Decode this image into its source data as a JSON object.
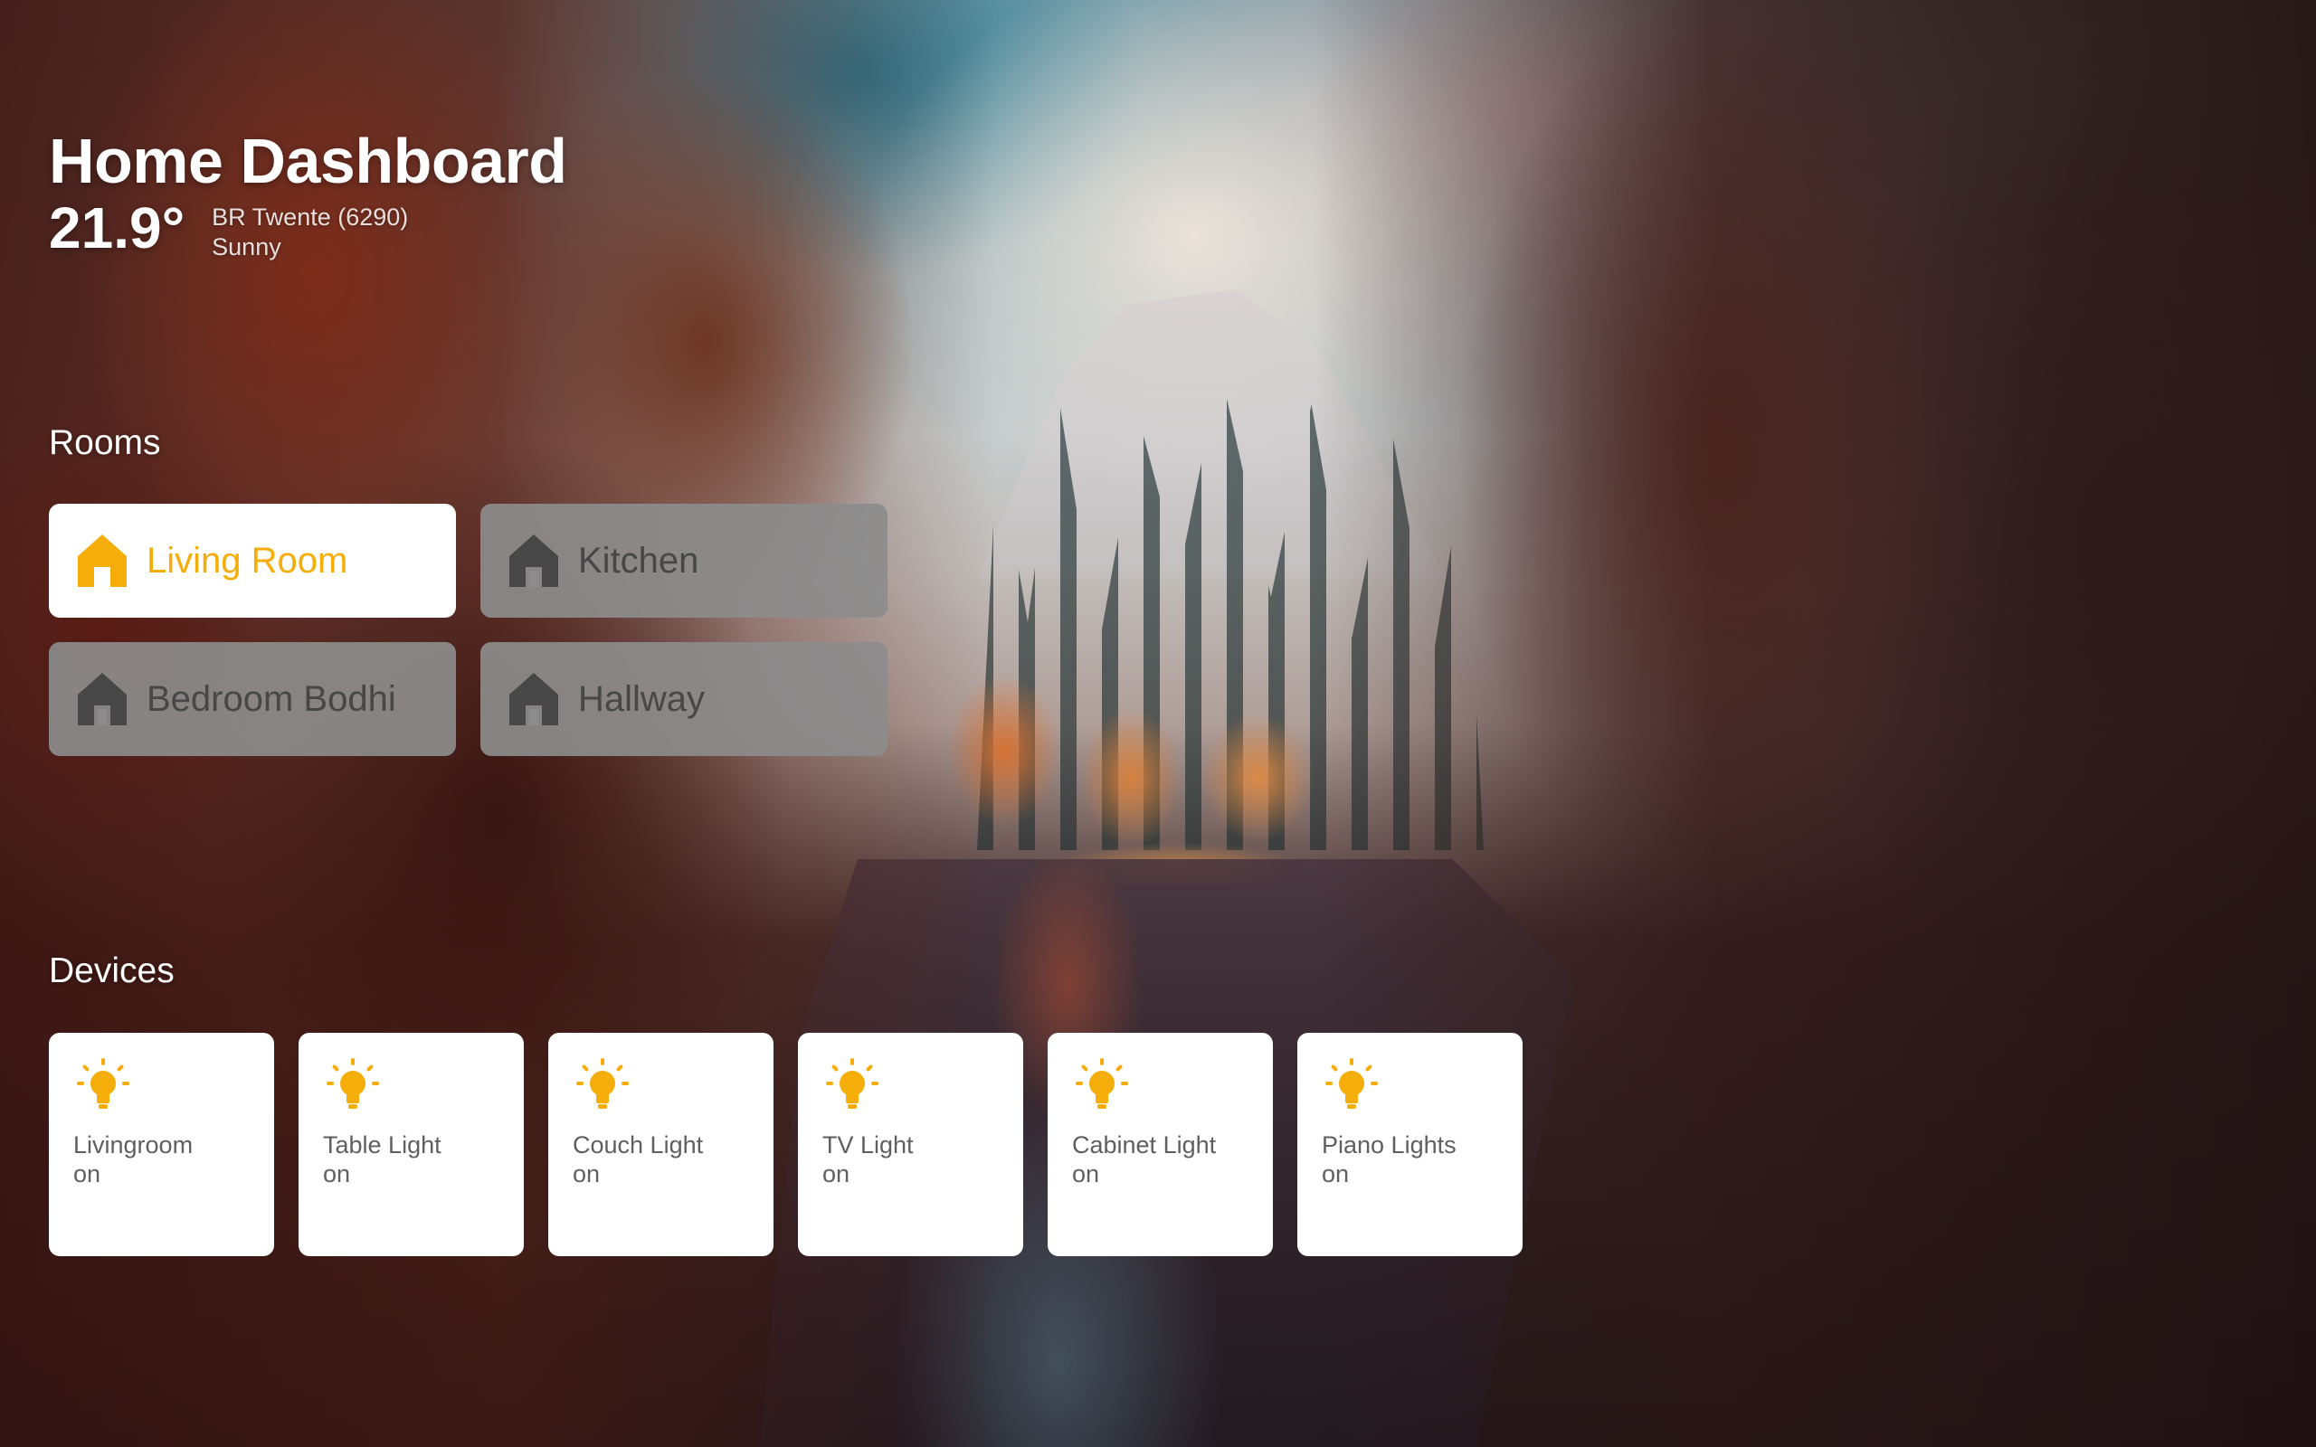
{
  "header": {
    "title": "Home Dashboard"
  },
  "weather": {
    "temperature": "21.9°",
    "station": "BR Twente (6290)",
    "condition": "Sunny"
  },
  "rooms": {
    "title": "Rooms",
    "items": [
      {
        "label": "Living Room",
        "active": true,
        "icon": "home-icon"
      },
      {
        "label": "Kitchen",
        "active": false,
        "icon": "home-icon"
      },
      {
        "label": "Bedroom Bodhi",
        "active": false,
        "icon": "home-icon"
      },
      {
        "label": "Hallway",
        "active": false,
        "icon": "home-icon"
      }
    ]
  },
  "devices": {
    "title": "Devices",
    "items": [
      {
        "name": "Livingroom",
        "state": "on",
        "icon": "lightbulb-icon"
      },
      {
        "name": "Table Light",
        "state": "on",
        "icon": "lightbulb-icon"
      },
      {
        "name": "Couch Light",
        "state": "on",
        "icon": "lightbulb-icon"
      },
      {
        "name": "TV Light",
        "state": "on",
        "icon": "lightbulb-icon"
      },
      {
        "name": "Cabinet Light",
        "state": "on",
        "icon": "lightbulb-icon"
      },
      {
        "name": "Piano Lights",
        "state": "on",
        "icon": "lightbulb-icon"
      }
    ]
  },
  "colors": {
    "accent": "#f5ad0a",
    "inactive_card": "#8c8c8c",
    "inactive_icon": "#474747",
    "card_text": "#5f5f5f"
  }
}
